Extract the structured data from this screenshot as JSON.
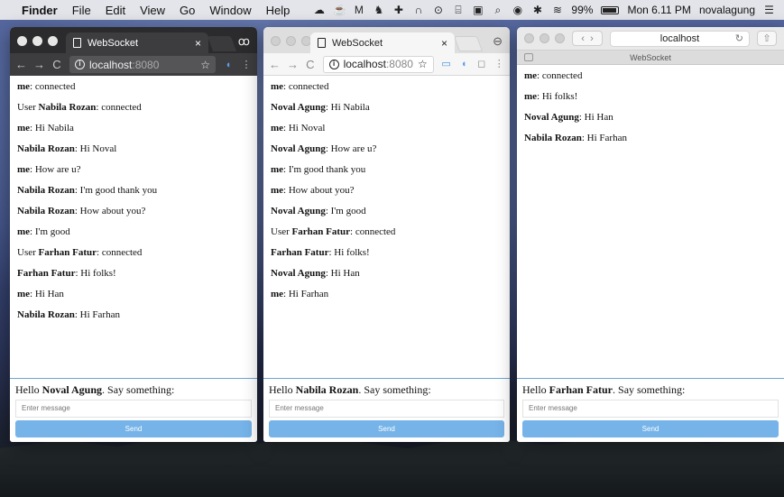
{
  "menubar": {
    "apple": "",
    "items": [
      "Finder",
      "File",
      "Edit",
      "View",
      "Go",
      "Window",
      "Help"
    ],
    "battery": "99%",
    "clock": "Mon 6.11 PM",
    "user": "novalagung"
  },
  "chrome_dark": {
    "tab_title": "WebSocket",
    "address_host": "localhost",
    "address_port": ":8080",
    "messages": [
      {
        "prefix": "",
        "name": "me",
        "text": ": connected"
      },
      {
        "prefix": "User ",
        "name": "Nabila Rozan",
        "text": ": connected"
      },
      {
        "prefix": "",
        "name": "me",
        "text": ": Hi Nabila"
      },
      {
        "prefix": "",
        "name": "Nabila Rozan",
        "text": ": Hi Noval"
      },
      {
        "prefix": "",
        "name": "me",
        "text": ": How are u?"
      },
      {
        "prefix": "",
        "name": "Nabila Rozan",
        "text": ": I'm good thank you"
      },
      {
        "prefix": "",
        "name": "Nabila Rozan",
        "text": ": How about you?"
      },
      {
        "prefix": "",
        "name": "me",
        "text": ": I'm good"
      },
      {
        "prefix": "User ",
        "name": "Farhan Fatur",
        "text": ": connected"
      },
      {
        "prefix": "",
        "name": "Farhan Fatur",
        "text": ": Hi folks!"
      },
      {
        "prefix": "",
        "name": "me",
        "text": ": Hi Han"
      },
      {
        "prefix": "",
        "name": "Nabila Rozan",
        "text": ": Hi Farhan"
      }
    ],
    "greeting_pre": "Hello ",
    "greeting_name": "Noval Agung",
    "greeting_post": ". Say something:",
    "input_placeholder": "Enter message",
    "send_label": "Send"
  },
  "chrome_light": {
    "tab_title": "WebSocket",
    "address_host": "localhost",
    "address_port": ":8080",
    "messages": [
      {
        "prefix": "",
        "name": "me",
        "text": ": connected"
      },
      {
        "prefix": "",
        "name": "Noval Agung",
        "text": ": Hi Nabila"
      },
      {
        "prefix": "",
        "name": "me",
        "text": ": Hi Noval"
      },
      {
        "prefix": "",
        "name": "Noval Agung",
        "text": ": How are u?"
      },
      {
        "prefix": "",
        "name": "me",
        "text": ": I'm good thank you"
      },
      {
        "prefix": "",
        "name": "me",
        "text": ": How about you?"
      },
      {
        "prefix": "",
        "name": "Noval Agung",
        "text": ": I'm good"
      },
      {
        "prefix": "User ",
        "name": "Farhan Fatur",
        "text": ": connected"
      },
      {
        "prefix": "",
        "name": "Farhan Fatur",
        "text": ": Hi folks!"
      },
      {
        "prefix": "",
        "name": "Noval Agung",
        "text": ": Hi Han"
      },
      {
        "prefix": "",
        "name": "me",
        "text": ": Hi Farhan"
      }
    ],
    "greeting_pre": "Hello ",
    "greeting_name": "Nabila Rozan",
    "greeting_post": ". Say something:",
    "input_placeholder": "Enter message",
    "send_label": "Send"
  },
  "safari": {
    "address": "localhost",
    "tab_title": "WebSocket",
    "messages": [
      {
        "prefix": "",
        "name": "me",
        "text": ": connected"
      },
      {
        "prefix": "",
        "name": "me",
        "text": ": Hi folks!"
      },
      {
        "prefix": "",
        "name": "Noval Agung",
        "text": ": Hi Han"
      },
      {
        "prefix": "",
        "name": "Nabila Rozan",
        "text": ": Hi Farhan"
      }
    ],
    "greeting_pre": "Hello ",
    "greeting_name": "Farhan Fatur",
    "greeting_post": ". Say something:",
    "input_placeholder": "Enter message",
    "send_label": "Send"
  },
  "colors": {
    "send_button": "#75b3e8",
    "composer_border": "#6aa6d6"
  }
}
